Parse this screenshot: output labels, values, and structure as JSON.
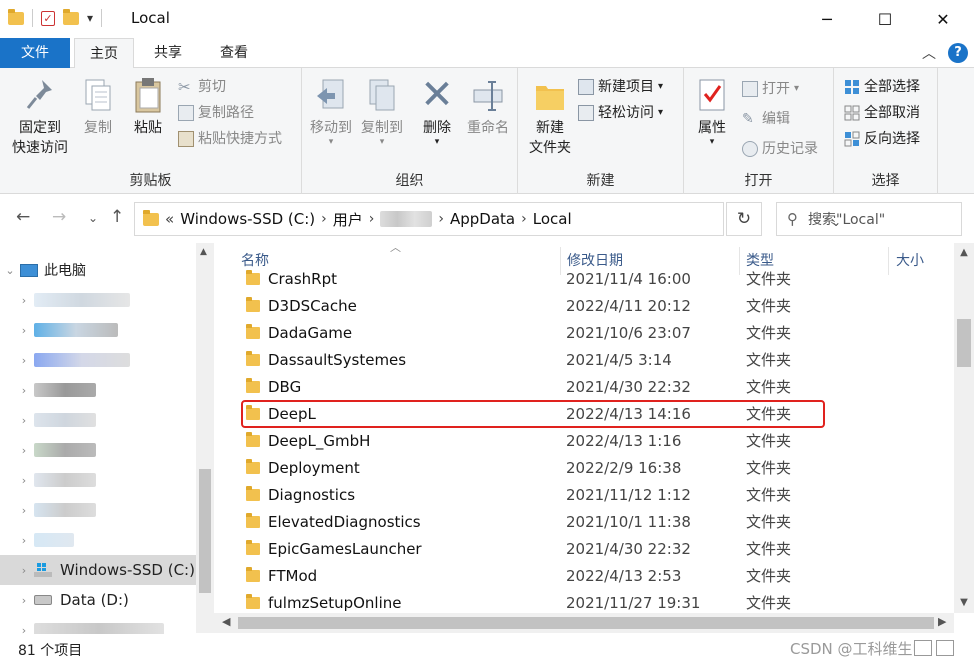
{
  "window": {
    "title": "Local",
    "minimize_glyph": "─",
    "maximize_glyph": "☐",
    "close_glyph": "✕",
    "qat_dropdown": "▾"
  },
  "tabs": {
    "file": "文件",
    "home": "主页",
    "share": "共享",
    "view": "查看",
    "help": "?",
    "collapse_glyph": "︿"
  },
  "ribbon": {
    "clipboard": {
      "label": "剪贴板",
      "pin": "固定到\n快速访问",
      "pin_line1": "固定到",
      "pin_line2": "快速访问",
      "copy": "复制",
      "paste": "粘贴",
      "cut": "剪切",
      "copy_path": "复制路径",
      "paste_shortcut": "粘贴快捷方式"
    },
    "organize": {
      "label": "组织",
      "move_to": "移动到",
      "copy_to": "复制到",
      "delete": "删除",
      "rename": "重命名"
    },
    "new": {
      "label": "新建",
      "new_folder_line1": "新建",
      "new_folder_line2": "文件夹",
      "new_item": "新建项目",
      "easy_access": "轻松访问"
    },
    "open": {
      "label": "打开",
      "properties": "属性",
      "open": "打开",
      "edit": "编辑",
      "history": "历史记录"
    },
    "select": {
      "label": "选择",
      "select_all": "全部选择",
      "select_none": "全部取消",
      "invert": "反向选择"
    }
  },
  "address": {
    "prefix": "«",
    "segments": [
      "Windows-SSD (C:)",
      "用户",
      "AppData",
      "Local"
    ],
    "separator": "›",
    "search_placeholder": "搜索\"Local\""
  },
  "nav_pane": {
    "this_pc": "此电脑",
    "windows_drive": "Windows-SSD (C:)",
    "data_drive": "Data (D:)"
  },
  "columns": {
    "name": "名称",
    "modified": "修改日期",
    "type": "类型",
    "size": "大小"
  },
  "files": [
    {
      "name": "CrashRpt",
      "date": "2021/11/4 16:00",
      "type": "文件夹"
    },
    {
      "name": "D3DSCache",
      "date": "2022/4/11 20:12",
      "type": "文件夹"
    },
    {
      "name": "DadaGame",
      "date": "2021/10/6 23:07",
      "type": "文件夹"
    },
    {
      "name": "DassaultSystemes",
      "date": "2021/4/5 3:14",
      "type": "文件夹"
    },
    {
      "name": "DBG",
      "date": "2021/4/30 22:32",
      "type": "文件夹"
    },
    {
      "name": "DeepL",
      "date": "2022/4/13 14:16",
      "type": "文件夹"
    },
    {
      "name": "DeepL_GmbH",
      "date": "2022/4/13 1:16",
      "type": "文件夹"
    },
    {
      "name": "Deployment",
      "date": "2022/2/9 16:38",
      "type": "文件夹"
    },
    {
      "name": "Diagnostics",
      "date": "2021/11/12 1:12",
      "type": "文件夹"
    },
    {
      "name": "ElevatedDiagnostics",
      "date": "2021/10/1 11:38",
      "type": "文件夹"
    },
    {
      "name": "EpicGamesLauncher",
      "date": "2021/4/30 22:32",
      "type": "文件夹"
    },
    {
      "name": "FTMod",
      "date": "2022/4/13 2:53",
      "type": "文件夹"
    },
    {
      "name": "fulmzSetupOnline",
      "date": "2021/11/27 19:31",
      "type": "文件夹"
    }
  ],
  "status": {
    "count": "81 个项目",
    "watermark": "CSDN @工科维生中"
  }
}
